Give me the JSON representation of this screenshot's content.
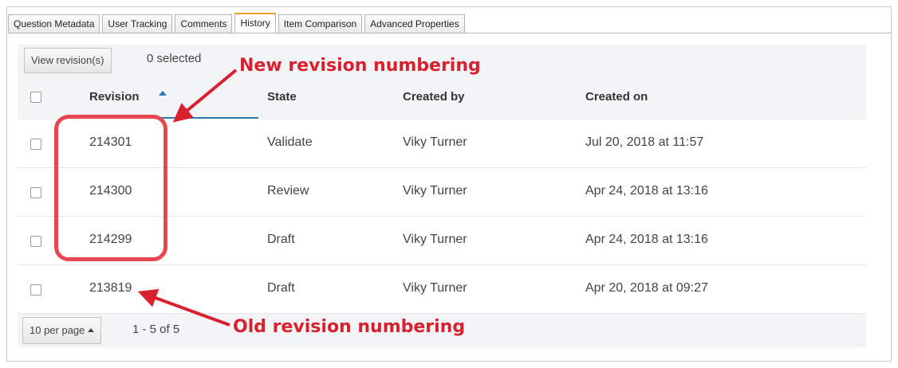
{
  "tabs": [
    {
      "label": "Question Metadata",
      "active": false
    },
    {
      "label": "User Tracking",
      "active": false
    },
    {
      "label": "Comments",
      "active": false
    },
    {
      "label": "History",
      "active": true
    },
    {
      "label": "Item Comparison",
      "active": false
    },
    {
      "label": "Advanced Properties",
      "active": false
    }
  ],
  "toolbar": {
    "view_button": "View revision(s)",
    "selected_text": "0 selected"
  },
  "table": {
    "columns": [
      "Revision",
      "State",
      "Created by",
      "Created on"
    ],
    "sort_column": "Revision",
    "sort_direction": "ascending-caret",
    "rows": [
      {
        "revision": "214301",
        "state": "Validate",
        "created_by": "Viky Turner",
        "created_on": "Jul 20, 2018 at 11:57"
      },
      {
        "revision": "214300",
        "state": "Review",
        "created_by": "Viky Turner",
        "created_on": "Apr 24, 2018 at 13:16"
      },
      {
        "revision": "214299",
        "state": "Draft",
        "created_by": "Viky Turner",
        "created_on": "Apr 24, 2018 at 13:16"
      },
      {
        "revision": "213819",
        "state": "Draft",
        "created_by": "Viky Turner",
        "created_on": "Apr 20, 2018 at 09:27"
      }
    ]
  },
  "footer": {
    "per_page": "10 per page",
    "pager": "1 - 5 of 5"
  },
  "annotations": {
    "new": "New revision numbering",
    "old": "Old revision numbering"
  },
  "colors": {
    "annotation": "#d9202f",
    "tab_active_accent": "#f0a030",
    "sort_accent": "#2a7ab0"
  }
}
